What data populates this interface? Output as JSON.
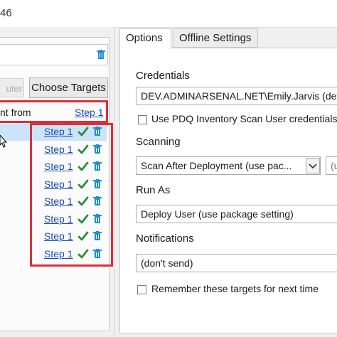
{
  "window": {
    "title_fragment": "46"
  },
  "left_pane": {
    "add_button_label": "uter",
    "choose_targets_label": "Choose Targets",
    "header_label": "nt from",
    "header_step_link": "Step 1",
    "rows": [
      {
        "step": "Step 1",
        "selected": true
      },
      {
        "step": "Step 1",
        "selected": false
      },
      {
        "step": "Step 1",
        "selected": false
      },
      {
        "step": "Step 1",
        "selected": false
      },
      {
        "step": "Step 1",
        "selected": false
      },
      {
        "step": "Step 1",
        "selected": false
      },
      {
        "step": "Step 1",
        "selected": false
      },
      {
        "step": "Step 1",
        "selected": false
      }
    ]
  },
  "tabs": [
    {
      "label": "Options",
      "active": true
    },
    {
      "label": "Offline Settings",
      "active": false
    }
  ],
  "options": {
    "credentials_label": "Credentials",
    "credentials_value": "DEV.ADMINARSENAL.NET\\Emily.Jarvis (defa",
    "use_scan_user_label": "Use PDQ Inventory Scan User credentials",
    "use_scan_user_checked": false,
    "scanning_label": "Scanning",
    "scanning_value": "Scan After Deployment (use pac...",
    "scanning_extra_value": "(u",
    "run_as_label": "Run As",
    "run_as_value": "Deploy User (use package setting)",
    "notifications_label": "Notifications",
    "notifications_value": "(don't send)",
    "remember_label": "Remember these targets for next time",
    "remember_checked": false
  },
  "colors": {
    "accent_red": "#d9303a",
    "link_blue": "#1a49b8",
    "check_green": "#2e8b3e",
    "trash_blue": "#1f8fd6",
    "selection": "#cce4f7"
  },
  "icons": {
    "status": "check-icon",
    "delete": "trash-icon"
  }
}
